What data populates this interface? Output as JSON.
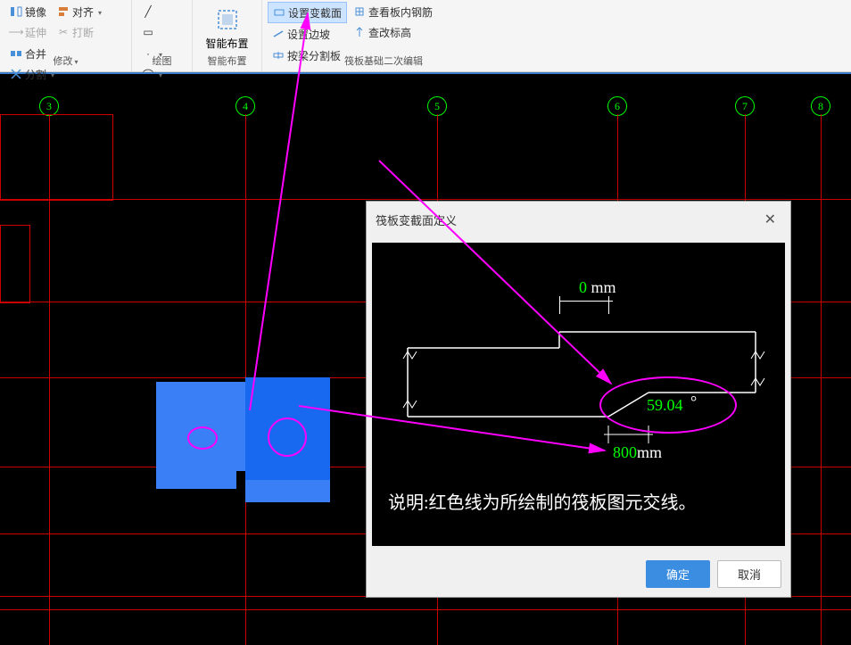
{
  "ribbon": {
    "group_modify": {
      "label": "修改",
      "mirror": "镜像",
      "align": "对齐",
      "merge": "合并",
      "extend": "延伸",
      "break": "打断",
      "split": "分割"
    },
    "group_draw": {
      "label": "绘图"
    },
    "group_smart": {
      "label": "智能布置",
      "btn": "智能布置"
    },
    "group_edit": {
      "label": "筏板基础二次编辑",
      "set_section": "设置变截面",
      "set_slope": "设置边坡",
      "view_rebar": "查看板内钢筋",
      "change_elev": "查改标高",
      "split_by_beam": "按梁分割板"
    }
  },
  "grid_labels": [
    "3",
    "4",
    "5",
    "6",
    "7",
    "8"
  ],
  "dialog": {
    "title": "筏板变截面定义",
    "dims": {
      "top_value": "0",
      "top_unit": "mm",
      "angle_value": "59.04",
      "angle_unit": "°",
      "bottom_value": "800",
      "bottom_unit": "mm"
    },
    "note": "说明:红色线为所绘制的筏板图元交线。",
    "ok": "确定",
    "cancel": "取消"
  }
}
